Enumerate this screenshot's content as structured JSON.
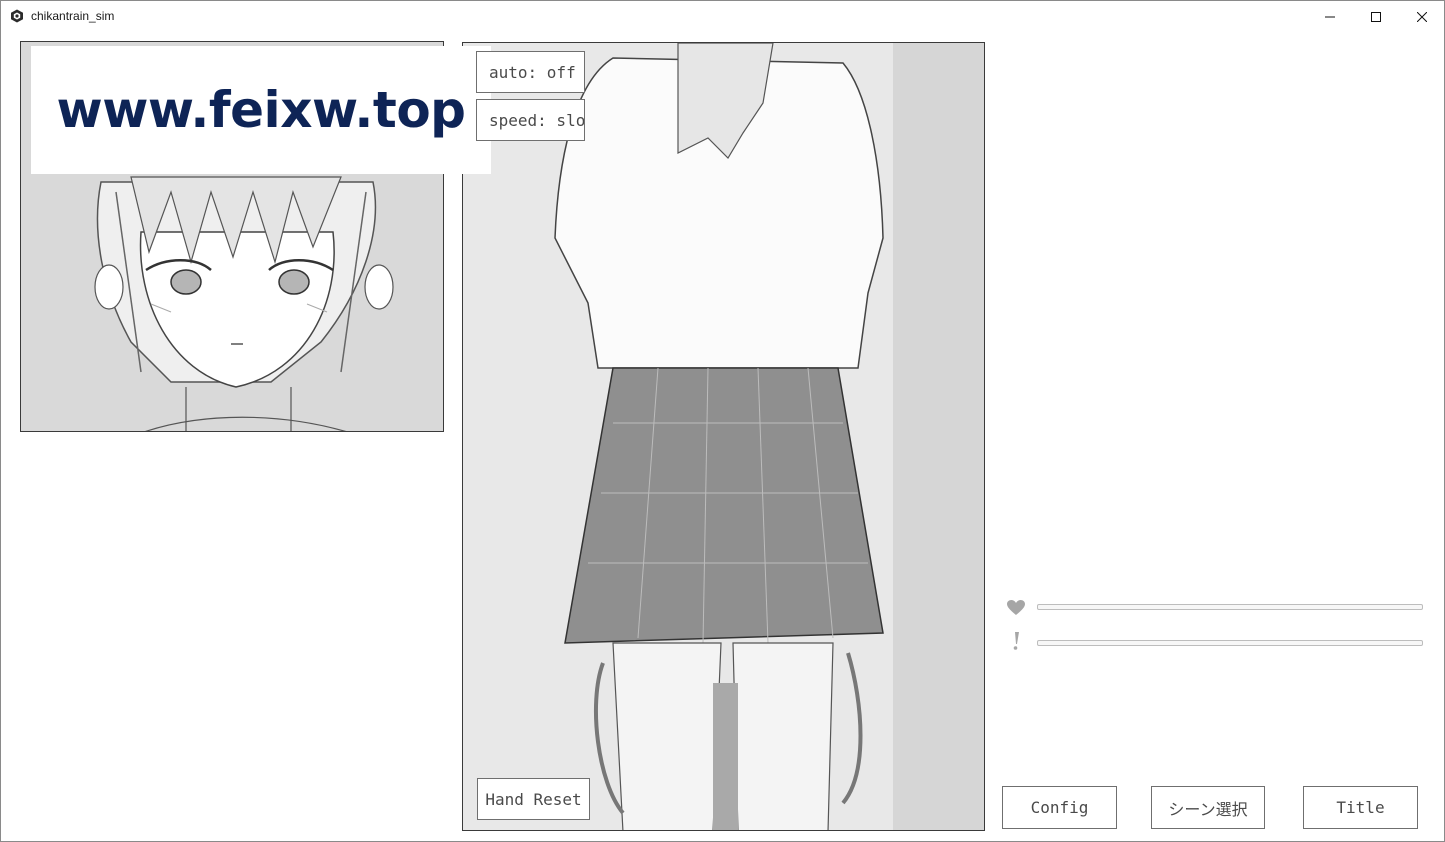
{
  "window": {
    "title": "chikantrain_sim",
    "controls": [
      "minimize",
      "maximize",
      "close"
    ]
  },
  "watermark": {
    "text": "www.feixw.top"
  },
  "overlay_controls": {
    "auto_label": "auto: off",
    "speed_label": "speed: slow"
  },
  "scene": {
    "hand_reset_label": "Hand Reset"
  },
  "gauges": {
    "arousal": {
      "icon": "heart-icon",
      "value": 0.0
    },
    "alert": {
      "icon": "exclamation-icon",
      "value": 0.0
    }
  },
  "menu": {
    "config_label": "Config",
    "scene_select_label": "シーン選択",
    "title_label": "Title"
  },
  "colors": {
    "panel_border": "#3a3a3a",
    "button_border": "#6f6f6f",
    "button_text": "#4a4a4a",
    "gauge_border": "#bdbdbd",
    "watermark_text": "#0e2456"
  }
}
